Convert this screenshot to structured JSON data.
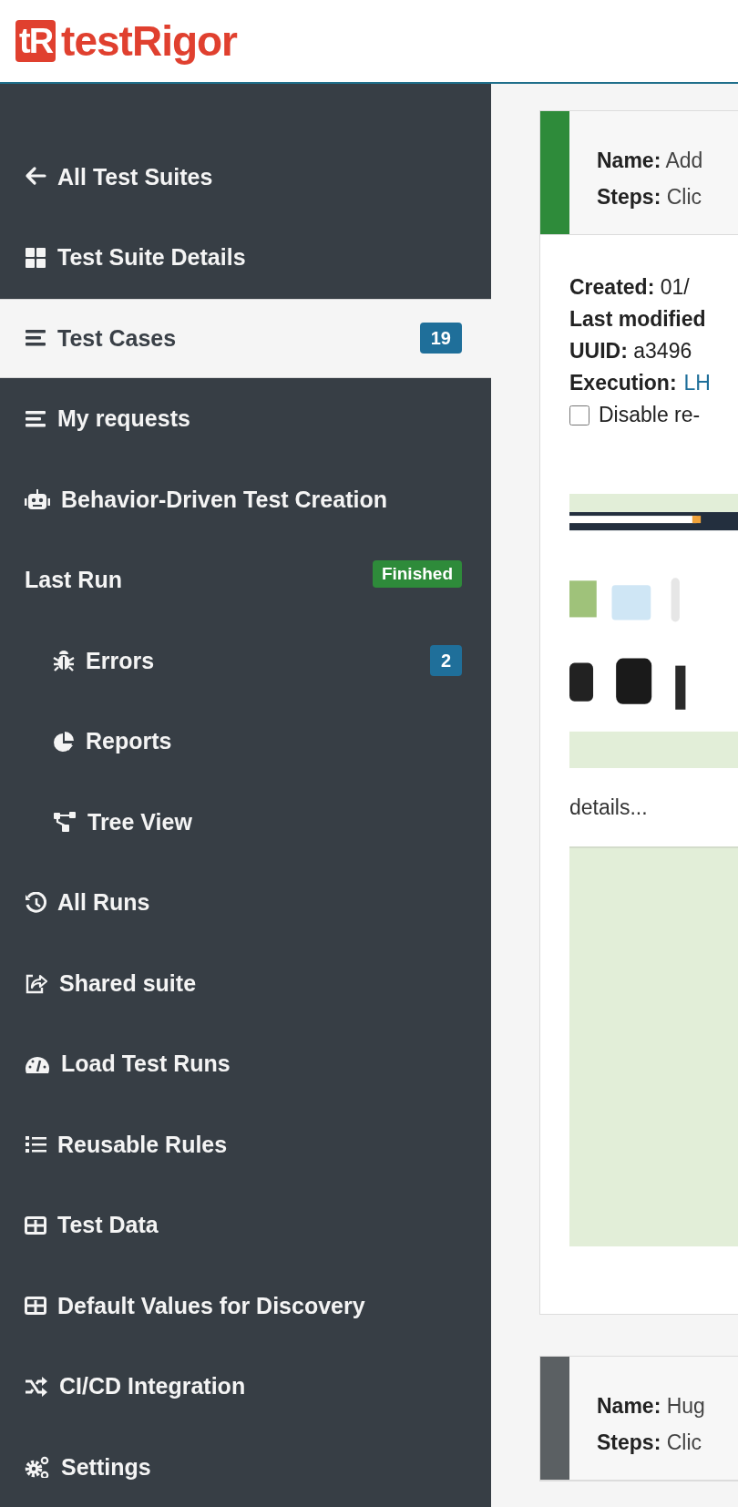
{
  "header": {
    "logo_mark": "tR",
    "logo_text": "testRigor"
  },
  "sidebar": {
    "items": [
      {
        "label": "All Test Suites",
        "selected": false
      },
      {
        "label": "Test Suite Details",
        "selected": false
      },
      {
        "label": "Test Cases",
        "selected": true,
        "badge": "19"
      },
      {
        "label": "My requests",
        "selected": false
      },
      {
        "label": "Behavior-Driven Test Creation",
        "selected": false
      },
      {
        "label": "Last Run",
        "selected": false,
        "status": "Finished",
        "children": [
          {
            "label": "Errors",
            "selected": false,
            "badge": "2"
          },
          {
            "label": "Reports",
            "selected": false
          },
          {
            "label": "Tree View",
            "selected": false
          }
        ]
      },
      {
        "label": "All Runs",
        "selected": false
      },
      {
        "label": "Shared suite",
        "selected": false
      },
      {
        "label": "Load Test Runs",
        "selected": false
      },
      {
        "label": "Reusable Rules",
        "selected": false
      },
      {
        "label": "Test Data",
        "selected": false
      },
      {
        "label": "Default Values for Discovery",
        "selected": false
      },
      {
        "label": "CI/CD Integration",
        "selected": false
      },
      {
        "label": "Settings",
        "selected": false
      }
    ]
  },
  "cards": [
    {
      "color": "#2e8b3a",
      "fields": [
        "**Name:** Add",
        "**Steps:** Clic"
      ],
      "details": [
        {
          "kind": "text",
          "text": "**Created:** 01/"
        },
        {
          "kind": "text",
          "text": "**Last modified**"
        },
        {
          "kind": "text",
          "text": "**UUID:** a3496"
        },
        {
          "kind": "link",
          "label": "Execution:",
          "link": "LH"
        }
      ],
      "checkbox": {
        "label": "Disable re-",
        "checked": false
      },
      "screenshot": {
        "kind": "picture"
      },
      "more": "details..."
    },
    {
      "color": "#5b6063",
      "fields": [
        "**Name:** Hug",
        "**Steps:** Clic"
      ]
    }
  ]
}
